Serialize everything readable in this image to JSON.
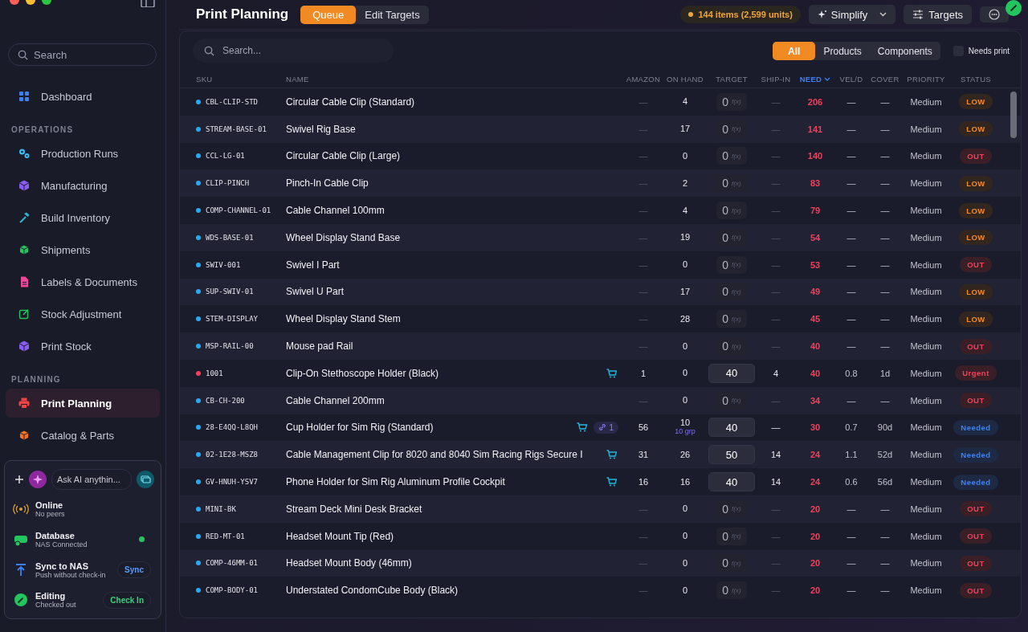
{
  "sidebar": {
    "search": {
      "placeholder": "Search"
    },
    "top_items": [
      {
        "label": "Dashboard",
        "selected": false
      }
    ],
    "sections": [
      {
        "title": "OPERATIONS",
        "items": [
          {
            "label": "Production Runs",
            "selected": false
          },
          {
            "label": "Manufacturing",
            "selected": false
          },
          {
            "label": "Build Inventory",
            "selected": false
          },
          {
            "label": "Shipments",
            "selected": false
          },
          {
            "label": "Labels & Documents",
            "selected": false
          },
          {
            "label": "Stock Adjustment",
            "selected": false
          },
          {
            "label": "Print Stock",
            "selected": false
          }
        ]
      },
      {
        "title": "PLANNING",
        "items": [
          {
            "label": "Print Planning",
            "selected": true
          },
          {
            "label": "Catalog & Parts",
            "selected": false
          }
        ]
      }
    ],
    "assistant": {
      "placeholder": "Ask AI anythin..."
    },
    "status_items": [
      {
        "kind": "network",
        "title": "Online",
        "subtitle": "No peers"
      },
      {
        "kind": "database",
        "title": "Database",
        "subtitle": "NAS Connected",
        "connected": true
      },
      {
        "kind": "sync",
        "title": "Sync to NAS",
        "subtitle": "Push without check-in",
        "action": "Sync"
      },
      {
        "kind": "editing",
        "title": "Editing",
        "subtitle": "Checked out",
        "action": "Check In"
      }
    ]
  },
  "header": {
    "title": "Print Planning",
    "tabs": [
      {
        "label": "Queue",
        "selected": true
      },
      {
        "label": "Edit Targets",
        "selected": false
      }
    ],
    "summary": "144 items (2,599 units)",
    "simplify": "Simplify",
    "targets": "Targets"
  },
  "filters": {
    "search": {
      "placeholder": "Search..."
    },
    "segments": [
      {
        "label": "All",
        "selected": true
      },
      {
        "label": "Products",
        "selected": false
      },
      {
        "label": "Components",
        "selected": false
      }
    ],
    "needs_print": {
      "label": "Needs print",
      "checked": false
    }
  },
  "table": {
    "columns": [
      {
        "label": "SKU",
        "sorted": false
      },
      {
        "label": "NAME",
        "sorted": false
      },
      {
        "label": "AMAZON",
        "sorted": false
      },
      {
        "label": "ON HAND",
        "sorted": false
      },
      {
        "label": "TARGET",
        "sorted": false
      },
      {
        "label": "SHIP-IN",
        "sorted": false
      },
      {
        "label": "NEED",
        "sorted": true
      },
      {
        "label": "VEL/D",
        "sorted": false
      },
      {
        "label": "COVER",
        "sorted": false
      },
      {
        "label": "PRIORITY",
        "sorted": false
      },
      {
        "label": "STATUS",
        "sorted": false
      }
    ],
    "rows": [
      {
        "sku": "CBL-CLIP-STD",
        "color": "#2aa8f0",
        "name": "Circular Cable Clip (Standard)",
        "amazon": "—",
        "on_hand": "4",
        "target": {
          "kind": "formula",
          "value": "0",
          "hint": "f(x)"
        },
        "ship_in": "—",
        "need": "206",
        "vel": "—",
        "cover": "—",
        "priority": "Medium",
        "status": {
          "kind": "low",
          "label": "LOW"
        }
      },
      {
        "sku": "STREAM-BASE-01",
        "color": "#2aa8f0",
        "name": "Swivel Rig Base",
        "amazon": "—",
        "on_hand": "17",
        "target": {
          "kind": "formula",
          "value": "0",
          "hint": "f(x)"
        },
        "ship_in": "—",
        "need": "141",
        "vel": "—",
        "cover": "—",
        "priority": "Medium",
        "status": {
          "kind": "low",
          "label": "LOW"
        }
      },
      {
        "sku": "CCL-LG-01",
        "color": "#2aa8f0",
        "name": "Circular Cable Clip (Large)",
        "amazon": "—",
        "on_hand": "0",
        "target": {
          "kind": "formula",
          "value": "0",
          "hint": "f(x)"
        },
        "ship_in": "—",
        "need": "140",
        "vel": "—",
        "cover": "—",
        "priority": "Medium",
        "status": {
          "kind": "out",
          "label": "OUT"
        }
      },
      {
        "sku": "CLIP-PINCH",
        "color": "#2aa8f0",
        "name": "Pinch-In Cable Clip",
        "amazon": "—",
        "on_hand": "2",
        "target": {
          "kind": "formula",
          "value": "0",
          "hint": "f(x)"
        },
        "ship_in": "—",
        "need": "83",
        "vel": "—",
        "cover": "—",
        "priority": "Medium",
        "status": {
          "kind": "low",
          "label": "LOW"
        }
      },
      {
        "sku": "COMP-CHANNEL-01",
        "color": "#2aa8f0",
        "name": "Cable Channel 100mm",
        "amazon": "—",
        "on_hand": "4",
        "target": {
          "kind": "formula",
          "value": "0",
          "hint": "f(x)"
        },
        "ship_in": "—",
        "need": "79",
        "vel": "—",
        "cover": "—",
        "priority": "Medium",
        "status": {
          "kind": "low",
          "label": "LOW"
        }
      },
      {
        "sku": "WDS-BASE-01",
        "color": "#2aa8f0",
        "name": "Wheel Display Stand Base",
        "amazon": "—",
        "on_hand": "19",
        "target": {
          "kind": "formula",
          "value": "0",
          "hint": "f(x)"
        },
        "ship_in": "—",
        "need": "54",
        "vel": "—",
        "cover": "—",
        "priority": "Medium",
        "status": {
          "kind": "low",
          "label": "LOW"
        }
      },
      {
        "sku": "SWIV-001",
        "color": "#2aa8f0",
        "name": "Swivel I Part",
        "amazon": "—",
        "on_hand": "0",
        "target": {
          "kind": "formula",
          "value": "0",
          "hint": "f(x)"
        },
        "ship_in": "—",
        "need": "53",
        "vel": "—",
        "cover": "—",
        "priority": "Medium",
        "status": {
          "kind": "out",
          "label": "OUT"
        }
      },
      {
        "sku": "SUP-SWIV-01",
        "color": "#2aa8f0",
        "name": "Swivel U Part",
        "amazon": "—",
        "on_hand": "17",
        "target": {
          "kind": "formula",
          "value": "0",
          "hint": "f(x)"
        },
        "ship_in": "—",
        "need": "49",
        "vel": "—",
        "cover": "—",
        "priority": "Medium",
        "status": {
          "kind": "low",
          "label": "LOW"
        }
      },
      {
        "sku": "STEM-DISPLAY",
        "color": "#2aa8f0",
        "name": "Wheel Display Stand Stem",
        "amazon": "—",
        "on_hand": "28",
        "target": {
          "kind": "formula",
          "value": "0",
          "hint": "f(x)"
        },
        "ship_in": "—",
        "need": "45",
        "vel": "—",
        "cover": "—",
        "priority": "Medium",
        "status": {
          "kind": "low",
          "label": "LOW"
        }
      },
      {
        "sku": "MSP-RAIL-00",
        "color": "#2aa8f0",
        "name": "Mouse pad Rail",
        "amazon": "—",
        "on_hand": "0",
        "target": {
          "kind": "formula",
          "value": "0",
          "hint": "f(x)"
        },
        "ship_in": "—",
        "need": "40",
        "vel": "—",
        "cover": "—",
        "priority": "Medium",
        "status": {
          "kind": "out",
          "label": "OUT"
        }
      },
      {
        "sku": "1001",
        "color": "#f0405a",
        "name": "Clip-On Stethoscope Holder (Black)",
        "cart": true,
        "amazon": "1",
        "on_hand": "0",
        "target": {
          "kind": "set",
          "value": "40"
        },
        "ship_in": "4",
        "need": "40",
        "vel": "0.8",
        "cover": "1d",
        "priority": "Medium",
        "status": {
          "kind": "urgent",
          "label": "Urgent"
        }
      },
      {
        "sku": "CB-CH-200",
        "color": "#2aa8f0",
        "name": "Cable Channel 200mm",
        "amazon": "—",
        "on_hand": "0",
        "target": {
          "kind": "formula",
          "value": "0",
          "hint": "f(x)"
        },
        "ship_in": "—",
        "need": "34",
        "vel": "—",
        "cover": "—",
        "priority": "Medium",
        "status": {
          "kind": "out",
          "label": "OUT"
        }
      },
      {
        "sku": "28-E4QQ-L8QH",
        "color": "#2aa8f0",
        "name": "Cup Holder for Sim Rig (Standard)",
        "cart": true,
        "links": "1",
        "amazon": "56",
        "on_hand": "10",
        "on_hand_note": "10 grp",
        "target": {
          "kind": "set",
          "value": "40"
        },
        "ship_in": "—",
        "need": "30",
        "vel": "0.7",
        "cover": "90d",
        "priority": "Medium",
        "status": {
          "kind": "needed",
          "label": "Needed"
        }
      },
      {
        "sku": "02-1E28-MSZ8",
        "color": "#2aa8f0",
        "name": "Cable Management Clip for 8020 and 8040 Sim Racing Rigs Secure I",
        "cart": true,
        "amazon": "31",
        "on_hand": "26",
        "target": {
          "kind": "set",
          "value": "50"
        },
        "ship_in": "14",
        "need": "24",
        "vel": "1.1",
        "cover": "52d",
        "priority": "Medium",
        "status": {
          "kind": "needed",
          "label": "Needed"
        }
      },
      {
        "sku": "GV-HNUH-YSV7",
        "color": "#2aa8f0",
        "name": "Phone Holder for Sim Rig Aluminum Profile Cockpit",
        "cart": true,
        "amazon": "16",
        "on_hand": "16",
        "target": {
          "kind": "set",
          "value": "40"
        },
        "ship_in": "14",
        "need": "24",
        "vel": "0.6",
        "cover": "56d",
        "priority": "Medium",
        "status": {
          "kind": "needed",
          "label": "Needed"
        }
      },
      {
        "sku": "MINI-BK",
        "color": "#2aa8f0",
        "name": "Stream Deck Mini Desk Bracket",
        "amazon": "—",
        "on_hand": "0",
        "target": {
          "kind": "formula",
          "value": "0",
          "hint": "f(x)"
        },
        "ship_in": "—",
        "need": "20",
        "vel": "—",
        "cover": "—",
        "priority": "Medium",
        "status": {
          "kind": "out",
          "label": "OUT"
        }
      },
      {
        "sku": "RED-MT-01",
        "color": "#2aa8f0",
        "name": "Headset Mount Tip (Red)",
        "amazon": "—",
        "on_hand": "0",
        "target": {
          "kind": "formula",
          "value": "0",
          "hint": "f(x)"
        },
        "ship_in": "—",
        "need": "20",
        "vel": "—",
        "cover": "—",
        "priority": "Medium",
        "status": {
          "kind": "out",
          "label": "OUT"
        }
      },
      {
        "sku": "COMP-46MM-01",
        "color": "#2aa8f0",
        "name": "Headset Mount Body (46mm)",
        "amazon": "—",
        "on_hand": "0",
        "target": {
          "kind": "formula",
          "value": "0",
          "hint": "f(x)"
        },
        "ship_in": "—",
        "need": "20",
        "vel": "—",
        "cover": "—",
        "priority": "Medium",
        "status": {
          "kind": "out",
          "label": "OUT"
        }
      },
      {
        "sku": "COMP-BODY-01",
        "color": "#2aa8f0",
        "name": "Understated CondomCube Body (Black)",
        "amazon": "—",
        "on_hand": "0",
        "target": {
          "kind": "formula",
          "value": "0",
          "hint": "f(x)"
        },
        "ship_in": "—",
        "need": "20",
        "vel": "—",
        "cover": "—",
        "priority": "Medium",
        "status": {
          "kind": "out",
          "label": "OUT"
        }
      }
    ]
  }
}
